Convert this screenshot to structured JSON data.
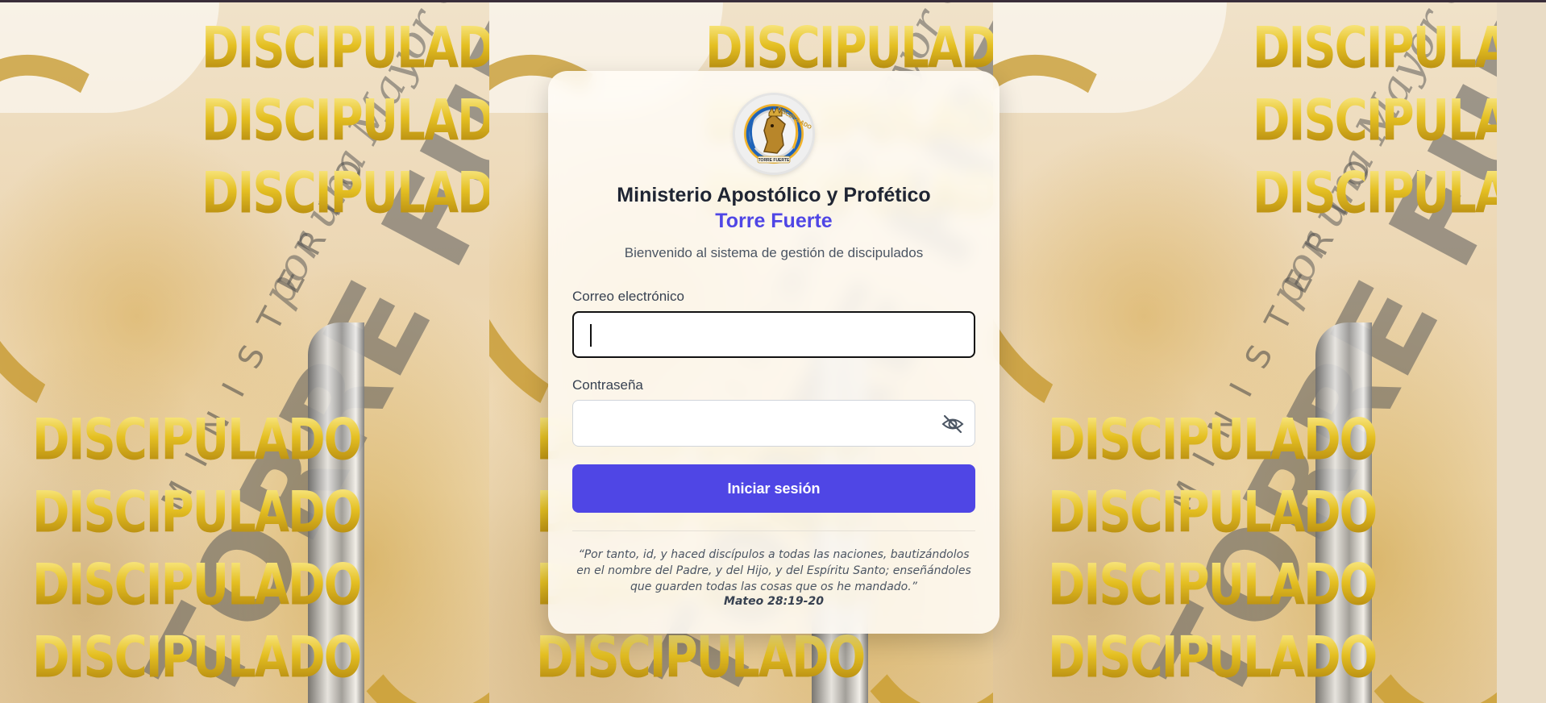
{
  "background": {
    "tile_word": "DISCIPULADO",
    "tile_big": "TORRE FUERTE",
    "tile_thin": "MINISTERIO",
    "tile_script": "por una Mayor Gloria"
  },
  "logo": {
    "top_text": "DISCIPULADO",
    "bottom_text": "TORRE FUERTE"
  },
  "header": {
    "title": "Ministerio Apostólico y Profético",
    "subtitle": "Torre Fuerte",
    "welcome": "Bienvenido al sistema de gestión de discipulados"
  },
  "form": {
    "email_label": "Correo electrónico",
    "email_value": "",
    "password_label": "Contraseña",
    "password_value": "",
    "submit_label": "Iniciar sesión"
  },
  "quote": {
    "text": "“Por tanto, id, y haced discípulos a todas las naciones, bautizándolos en el nombre del Padre, y del Hijo, y del Espíritu Santo; enseñándoles que guarden todas las cosas que os he mandado.”",
    "reference": "Mateo 28:19-20"
  },
  "colors": {
    "accent": "#4f46e5",
    "title": "#1f2533",
    "gold": "#d9b21b"
  },
  "icons": {
    "password_toggle": "eye-off-icon"
  }
}
